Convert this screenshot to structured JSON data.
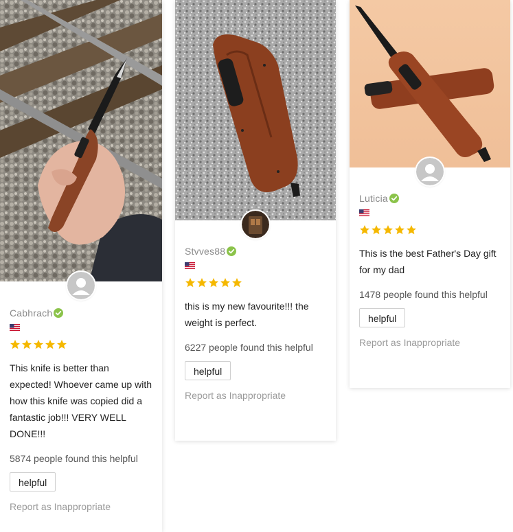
{
  "reviews": [
    {
      "name": "Cabhrach",
      "country": "United States",
      "rating": 5,
      "text": "This knife is better than expected! Whoever came up with how this knife was copied did a fantastic job!!! VERY WELL DONE!!!",
      "helpful_count": "5874 people found this helpful",
      "helpful_label": "helpful",
      "report_label": "Report as Inappropriate"
    },
    {
      "name": "Stvves88",
      "country": "United States",
      "rating": 5,
      "text": "this is my new favourite!!! the weight is perfect.",
      "helpful_count": "6227 people found this helpful",
      "helpful_label": "helpful",
      "report_label": "Report as Inappropriate"
    },
    {
      "name": "Luticia",
      "country": "United States",
      "rating": 5,
      "text": "This is the best Father's Day gift for my dad",
      "helpful_count": "1478 people found this helpful",
      "helpful_label": "helpful",
      "report_label": "Report as Inappropriate"
    }
  ],
  "colors": {
    "star": "#f5b800",
    "verified": "#8bc34a",
    "name": "#8a8a8a",
    "report": "#9a9a9a"
  },
  "icons": {
    "verified": "check-circle-icon",
    "star": "star-icon",
    "flag": "us-flag-icon",
    "avatar": "user-avatar-icon"
  }
}
